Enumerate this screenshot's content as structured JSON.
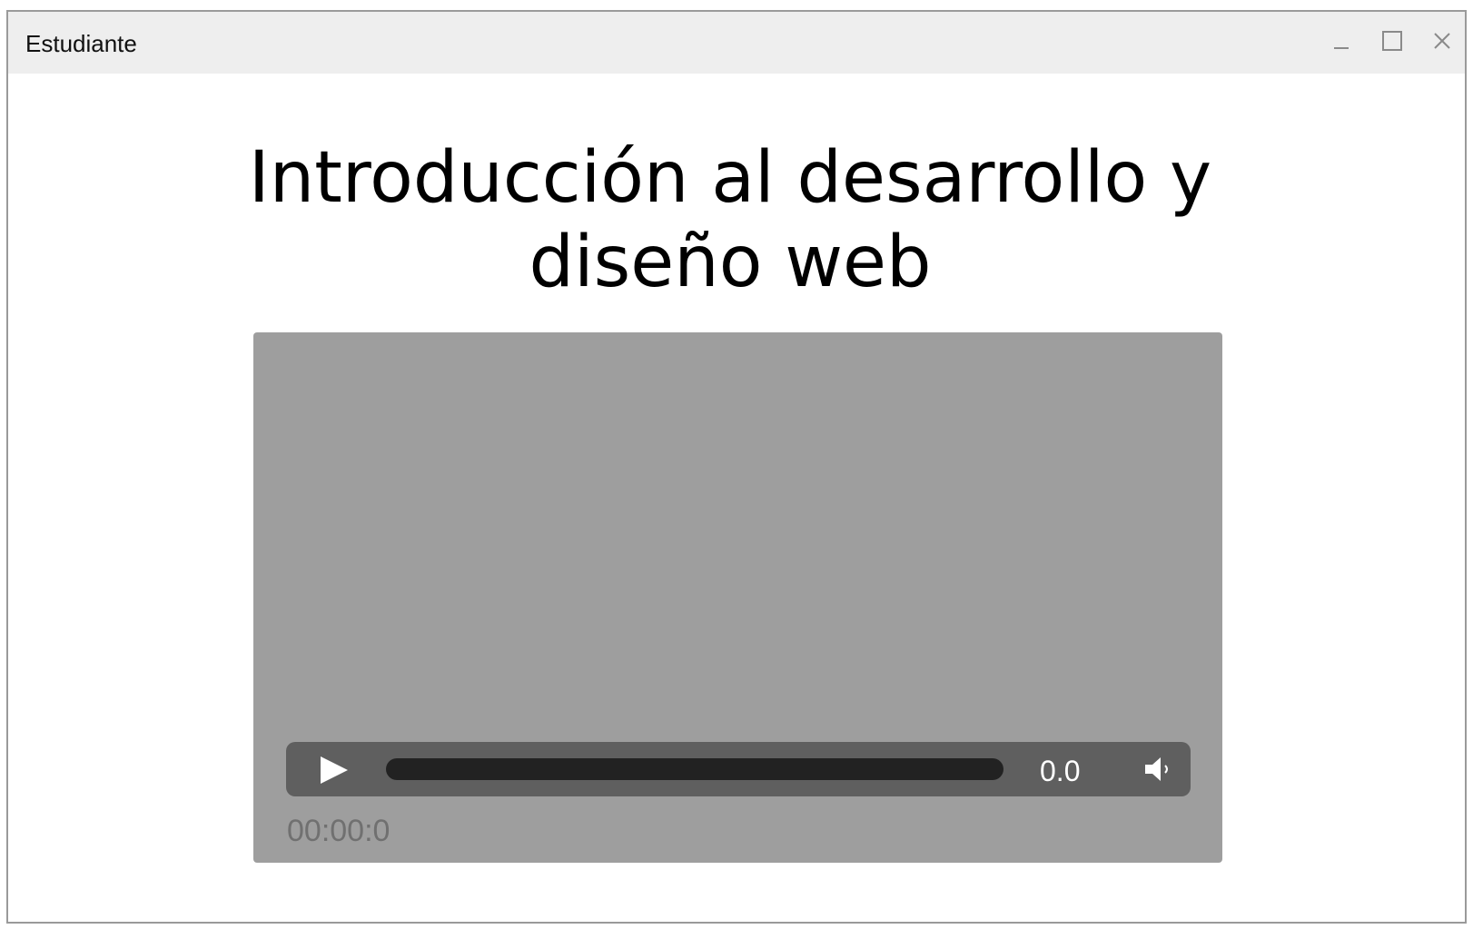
{
  "window": {
    "title": "Estudiante",
    "controls": {
      "minimize_icon": "minimize-icon",
      "maximize_icon": "maximize-icon",
      "close_icon": "close-icon"
    }
  },
  "main": {
    "title": "Introducción al desarrollo y diseño web"
  },
  "video_player": {
    "play_icon": "play-icon",
    "progress": 0,
    "volume_value": "0.0",
    "volume_icon": "speaker-icon",
    "timecode": "00:00:0"
  },
  "colors": {
    "titlebar_bg": "#eeeeee",
    "player_bg": "#9e9e9e",
    "controls_bg": "#5f5f5f",
    "track": "#222222",
    "timecode": "#707070"
  }
}
